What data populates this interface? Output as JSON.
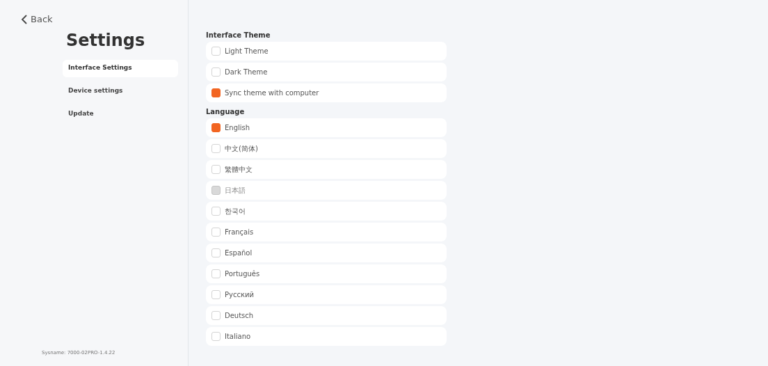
{
  "back": {
    "label": "Back"
  },
  "sidebar": {
    "title": "Settings",
    "items": [
      {
        "label": "Interface Settings",
        "selected": true
      },
      {
        "label": "Device settings",
        "selected": false
      },
      {
        "label": "Update",
        "selected": false
      }
    ],
    "footer": "Sysname: 7000-02PRO-1.4.22"
  },
  "sections": [
    {
      "title": "Interface Theme",
      "options": [
        {
          "label": "Light Theme",
          "checked": false,
          "disabled": false
        },
        {
          "label": "Dark Theme",
          "checked": false,
          "disabled": false
        },
        {
          "label": "Sync theme with computer",
          "checked": true,
          "disabled": false
        }
      ]
    },
    {
      "title": "Language",
      "options": [
        {
          "label": "English",
          "checked": true,
          "disabled": false
        },
        {
          "label": "中文(简体)",
          "checked": false,
          "disabled": false
        },
        {
          "label": "繁體中文",
          "checked": false,
          "disabled": false
        },
        {
          "label": "日本語",
          "checked": false,
          "disabled": true
        },
        {
          "label": "한국어",
          "checked": false,
          "disabled": false
        },
        {
          "label": "Français",
          "checked": false,
          "disabled": false
        },
        {
          "label": "Español",
          "checked": false,
          "disabled": false
        },
        {
          "label": "Português",
          "checked": false,
          "disabled": false
        },
        {
          "label": "Русский",
          "checked": false,
          "disabled": false
        },
        {
          "label": "Deutsch",
          "checked": false,
          "disabled": false
        },
        {
          "label": "Italiano",
          "checked": false,
          "disabled": false
        }
      ]
    }
  ]
}
